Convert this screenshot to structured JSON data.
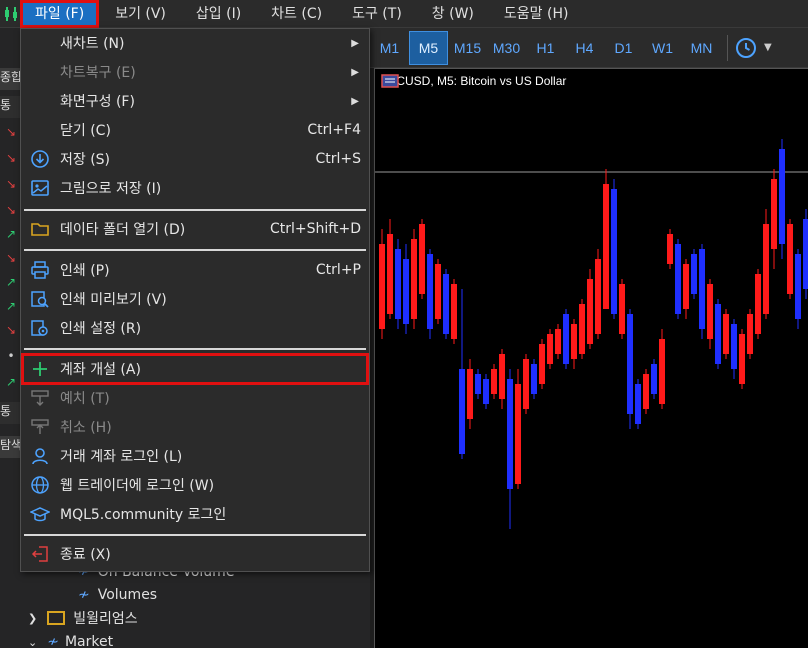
{
  "menubar": {
    "items": [
      "파일 (F)",
      "보기 (V)",
      "삽입 (I)",
      "차트 (C)",
      "도구 (T)",
      "창 (W)",
      "도움말 (H)"
    ]
  },
  "toolbar": {
    "timeframes": [
      "M1",
      "M5",
      "M15",
      "M30",
      "H1",
      "H4",
      "D1",
      "W1",
      "MN"
    ],
    "active_timeframe": "M5"
  },
  "chart": {
    "title": "BTCUSD, M5:  Bitcoin vs US Dollar",
    "colors": {
      "bull": "#ff1a1a",
      "bear": "#1f2fff",
      "background": "#000000",
      "price_line": "#9a9a9a"
    }
  },
  "left_panel": {
    "headers": [
      "종합",
      "통",
      "탐색"
    ],
    "tree": [
      "On Balance Volume",
      "Volumes",
      "빌윌리엄스",
      "Market"
    ]
  },
  "file_menu": {
    "items": [
      {
        "label": "새차트 (N)",
        "shortcut": "",
        "submenu": true,
        "icon": "",
        "disabled": false
      },
      {
        "label": "차트복구 (E)",
        "shortcut": "",
        "submenu": true,
        "icon": "",
        "disabled": true
      },
      {
        "label": "화면구성 (F)",
        "shortcut": "",
        "submenu": true,
        "icon": "",
        "disabled": false
      },
      {
        "label": "닫기 (C)",
        "shortcut": "Ctrl+F4",
        "submenu": false,
        "icon": "",
        "disabled": false
      },
      {
        "label": "저장 (S)",
        "shortcut": "Ctrl+S",
        "submenu": false,
        "icon": "save-icon",
        "disabled": false
      },
      {
        "label": "그림으로 저장 (I)",
        "shortcut": "",
        "submenu": false,
        "icon": "image-icon",
        "disabled": false
      },
      {
        "label": "데이타 폴더 열기 (D)",
        "shortcut": "Ctrl+Shift+D",
        "submenu": false,
        "icon": "folder-icon",
        "disabled": false
      },
      {
        "label": "인쇄 (P)",
        "shortcut": "Ctrl+P",
        "submenu": false,
        "icon": "print-icon",
        "disabled": false
      },
      {
        "label": "인쇄 미리보기 (V)",
        "shortcut": "",
        "submenu": false,
        "icon": "print-preview-icon",
        "disabled": false
      },
      {
        "label": "인쇄 설정 (R)",
        "shortcut": "",
        "submenu": false,
        "icon": "print-settings-icon",
        "disabled": false
      },
      {
        "label": "계좌 개설 (A)",
        "shortcut": "",
        "submenu": false,
        "icon": "plus-icon",
        "disabled": false
      },
      {
        "label": "예치 (T)",
        "shortcut": "",
        "submenu": false,
        "icon": "deposit-icon",
        "disabled": true
      },
      {
        "label": "취소 (H)",
        "shortcut": "",
        "submenu": false,
        "icon": "withdraw-icon",
        "disabled": true
      },
      {
        "label": "거래 계좌 로그인 (L)",
        "shortcut": "",
        "submenu": false,
        "icon": "user-icon",
        "disabled": false
      },
      {
        "label": "웹 트레이더에 로그인 (W)",
        "shortcut": "",
        "submenu": false,
        "icon": "globe-icon",
        "disabled": false
      },
      {
        "label": "MQL5.community 로그인",
        "shortcut": "",
        "submenu": false,
        "icon": "graduation-cap-icon",
        "disabled": false
      },
      {
        "label": "종료 (X)",
        "shortcut": "",
        "submenu": false,
        "icon": "exit-icon",
        "disabled": false
      }
    ]
  }
}
